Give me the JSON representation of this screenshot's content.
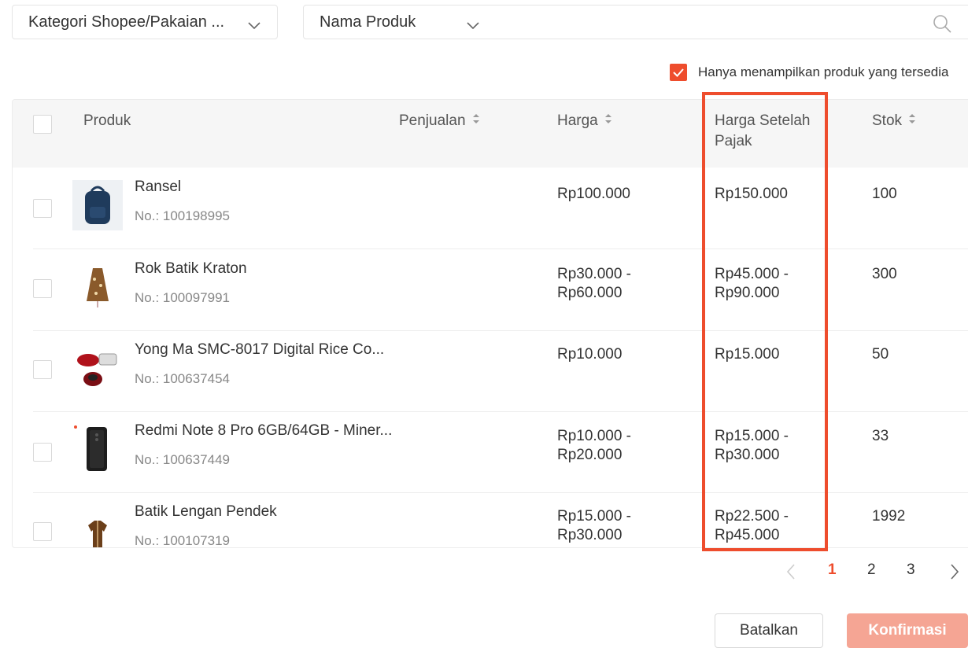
{
  "filters": {
    "category_value": "Kategori Shopee/Pakaian ...",
    "search_field_value": "Nama Produk",
    "search_placeholder": "",
    "only_available_label": "Hanya menampilkan produk yang tersedia",
    "only_available_checked": true
  },
  "table": {
    "headers": {
      "product": "Produk",
      "sales": "Penjualan",
      "price": "Harga",
      "price_after_tax": "Harga Setelah Pajak",
      "stock": "Stok"
    },
    "rows": [
      {
        "name": "Ransel",
        "no": "No.: 100198995",
        "price": [
          "Rp100.000"
        ],
        "price_after_tax": [
          "Rp150.000"
        ],
        "stock": "100"
      },
      {
        "name": "Rok Batik Kraton",
        "no": "No.: 100097991",
        "price": [
          "Rp30.000 -",
          "Rp60.000"
        ],
        "price_after_tax": [
          "Rp45.000 -",
          "Rp90.000"
        ],
        "stock": "300"
      },
      {
        "name": "Yong Ma SMC-8017 Digital Rice Co...",
        "no": "No.: 100637454",
        "price": [
          "Rp10.000"
        ],
        "price_after_tax": [
          "Rp15.000"
        ],
        "stock": "50"
      },
      {
        "name": "Redmi Note 8 Pro 6GB/64GB - Miner...",
        "no": "No.: 100637449",
        "price": [
          "Rp10.000 -",
          "Rp20.000"
        ],
        "price_after_tax": [
          "Rp15.000 -",
          "Rp30.000"
        ],
        "stock": "33"
      },
      {
        "name": "Batik Lengan Pendek",
        "no": "No.: 100107319",
        "price": [
          "Rp15.000 -",
          "Rp30.000"
        ],
        "price_after_tax": [
          "Rp22.500 -",
          "Rp45.000"
        ],
        "stock": "1992"
      }
    ]
  },
  "pagination": {
    "pages": [
      "1",
      "2",
      "3"
    ],
    "current": "1"
  },
  "actions": {
    "cancel_label": "Batalkan",
    "confirm_label": "Konfirmasi"
  },
  "colors": {
    "accent": "#ee4d2d",
    "highlight_border": "#ee4d2d",
    "confirm_disabled": "#f5a594"
  }
}
